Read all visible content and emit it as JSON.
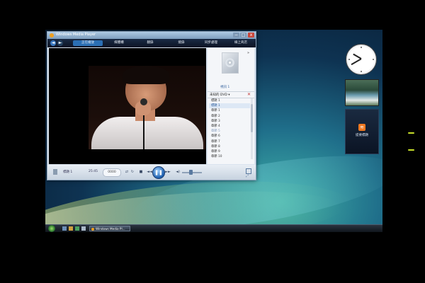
{
  "window": {
    "title": "Windows Media Player",
    "close_glyph": "x",
    "min_glyph": "−",
    "max_glyph": "□"
  },
  "nav": {
    "back_glyph": "◄",
    "forward_glyph": "►",
    "tabs": [
      "正在播放",
      "媒體櫃",
      "翻錄",
      "燒錄",
      "同步處理",
      "線上商店"
    ]
  },
  "panel": {
    "album_label": "視訊 1",
    "dvd_label": "未知的 DVD ▾",
    "close_glyph": "✕",
    "arrow_glyph": "»",
    "tracks": [
      "標題 1",
      "標題 1",
      "章節 1",
      "章節 2",
      "章節 3",
      "章節 4",
      "章節 5",
      "章節 6",
      "章節 7",
      "章節 8",
      "章節 9",
      "章節 10"
    ],
    "selected_index": 1,
    "dim_index": 6
  },
  "controls": {
    "now_playing": "標題 1",
    "time": "25:45",
    "speed_label": "0000",
    "shuffle": "⇄",
    "repeat": "↻",
    "stop": "■",
    "prev": "◄◄",
    "play": "❚❚",
    "next": "►►",
    "mute": "◄)"
  },
  "gadgets": {
    "feed_label": "提要標題",
    "rss_glyph": "≋"
  },
  "taskbar": {
    "task_label": "Windows Media Pl..."
  },
  "icons": [
    "wmp-icon",
    "back-icon",
    "forward-icon",
    "disc-icon",
    "rss-icon",
    "start-orb-icon",
    "clock-icon"
  ]
}
